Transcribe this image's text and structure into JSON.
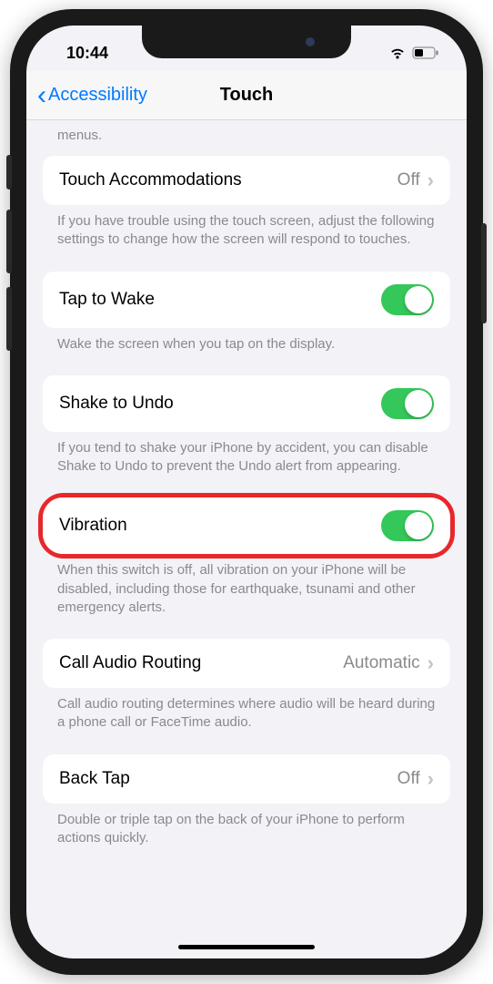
{
  "status": {
    "time": "10:44"
  },
  "nav": {
    "back_label": "Accessibility",
    "title": "Touch"
  },
  "truncated_footer": "menus.",
  "rows": {
    "touch_accommodations": {
      "label": "Touch Accommodations",
      "value": "Off",
      "footer": "If you have trouble using the touch screen, adjust the following settings to change how the screen will respond to touches."
    },
    "tap_to_wake": {
      "label": "Tap to Wake",
      "on": true,
      "footer": "Wake the screen when you tap on the display."
    },
    "shake_to_undo": {
      "label": "Shake to Undo",
      "on": true,
      "footer": "If you tend to shake your iPhone by accident, you can disable Shake to Undo to prevent the Undo alert from appearing."
    },
    "vibration": {
      "label": "Vibration",
      "on": true,
      "footer": "When this switch is off, all vibration on your iPhone will be disabled, including those for earthquake, tsunami and other emergency alerts."
    },
    "call_audio_routing": {
      "label": "Call Audio Routing",
      "value": "Automatic",
      "footer": "Call audio routing determines where audio will be heard during a phone call or FaceTime audio."
    },
    "back_tap": {
      "label": "Back Tap",
      "value": "Off",
      "footer": "Double or triple tap on the back of your iPhone to perform actions quickly."
    }
  }
}
